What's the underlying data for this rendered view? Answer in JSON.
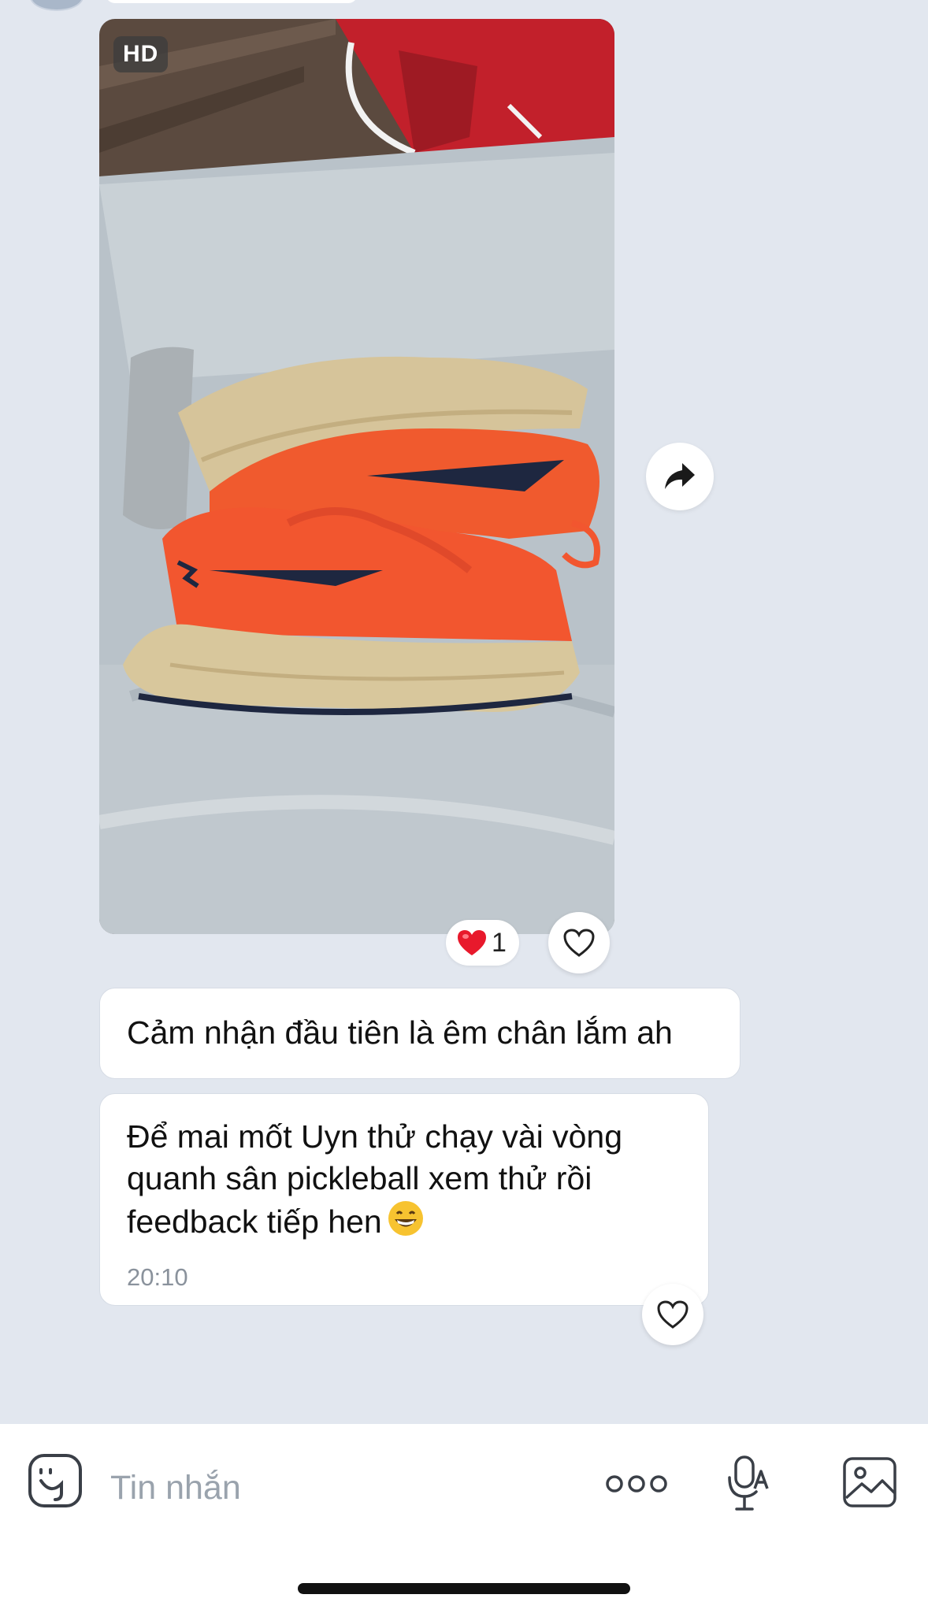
{
  "photo": {
    "hd_badge": "HD",
    "reaction_emoji": "❤️",
    "reaction_count": "1"
  },
  "messages": [
    {
      "text": "Cảm nhận đầu tiên là êm chân lắm ah"
    },
    {
      "text": "Để mai mốt  Uyn thử chạy vài vòng\nquanh sân pickleball xem thử rồi\nfeedback tiếp hen",
      "emoji": "😁",
      "time": "20:10"
    }
  ],
  "composer": {
    "placeholder": "Tin nhắn",
    "icons": [
      "sticker-icon",
      "more-icon",
      "voice-to-text-icon",
      "image-icon"
    ]
  },
  "colors": {
    "chat_background": "#e2e7ef",
    "bubble": "#ffffff",
    "shoe_orange": "#f2562f",
    "heart": "#e8192c"
  }
}
